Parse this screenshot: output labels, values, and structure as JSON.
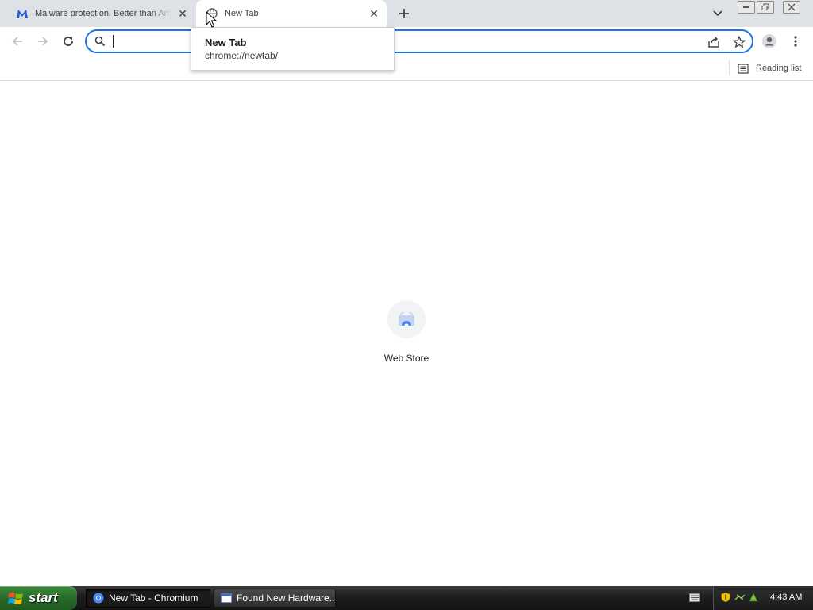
{
  "browser": {
    "tabs": [
      {
        "title": "Malware protection. Better than Antivirus",
        "active": false,
        "icon": "malwarebytes-icon"
      },
      {
        "title": "New Tab",
        "active": true,
        "icon": "globe-icon"
      }
    ],
    "omnibox": {
      "value": "",
      "placeholder": ""
    },
    "bookmarks_bar": {
      "reading_list_label": "Reading list"
    },
    "hover_card": {
      "title": "New Tab",
      "url": "chrome://newtab/"
    }
  },
  "newtab": {
    "shortcuts": [
      {
        "label": "Web Store",
        "icon": "webstore-icon"
      }
    ]
  },
  "taskbar": {
    "start_label": "start",
    "items": [
      {
        "label": "New Tab - Chromium",
        "active": true,
        "icon": "chromium-icon"
      },
      {
        "label": "Found New Hardware...",
        "active": false,
        "icon": "window-icon"
      }
    ],
    "clock": "4:43 AM"
  },
  "colors": {
    "accent": "#1a73e8",
    "tabstrip_bg": "#dee1e6",
    "taskbar_bg": "#1e1e1e",
    "start_green": "#2a6a2a"
  }
}
